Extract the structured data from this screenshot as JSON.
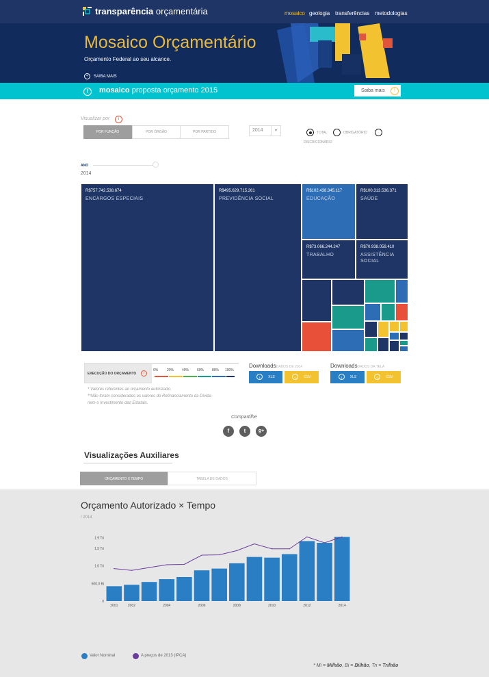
{
  "brand": {
    "bold": "transparência",
    "light": "orçamentária"
  },
  "nav": [
    "mosaico",
    "geologia",
    "transferências",
    "metodologias"
  ],
  "hero": {
    "title": "Mosaico Orçamentário",
    "subtitle": "Orçamento Federal ao seu alcance.",
    "more": "SAIBA MAIS"
  },
  "banner": {
    "bold": "mosaico",
    "text": "proposta orçamento 2015",
    "button": "Saiba mais"
  },
  "controls": {
    "visualizar": "Visualizar por",
    "segments": [
      "POR FUNÇÃO",
      "POR ÓRGÃO",
      "POR PARTIDO"
    ],
    "year": "2014",
    "radios": [
      "TOTAL",
      "OBRIGATÓRIO",
      "DISCRICIONÁRIO"
    ],
    "ano_label": "ANO",
    "ano_value": "2014"
  },
  "treemap": [
    {
      "value": "R$757.742.538.674",
      "name": "ENCARGOS ESPECIAIS",
      "color": "#1e3565"
    },
    {
      "value": "R$495.629.715.261",
      "name": "PREVIDÊNCIA SOCIAL",
      "color": "#1e3565"
    },
    {
      "value": "R$102.438.345.117",
      "name": "EDUCAÇÃO",
      "color": "#2c6db5"
    },
    {
      "value": "R$100.313.536.371",
      "name": "SAÚDE",
      "color": "#1e3565"
    },
    {
      "value": "R$73.066.244.247",
      "name": "TRABALHO",
      "color": "#1e3565"
    },
    {
      "value": "R$70.938.059.410",
      "name": "ASSISTÊNCIA SOCIAL",
      "color": "#1e3565"
    }
  ],
  "execucao": {
    "label": "EXECUÇÃO DO ORÇAMENTO",
    "ticks": [
      "0%",
      "20%",
      "40%",
      "60%",
      "80%",
      "100%"
    ],
    "colors": [
      "#e0563c",
      "#f2c230",
      "#4caf50",
      "#1a9a8a",
      "#2c6db5",
      "#1e3565"
    ]
  },
  "notes": [
    "* Valores referentes ao orçamento autorizado.",
    "**Não foram considerados os valores do Refinanciamento da Dívida",
    "nem o Investimento das Estatais."
  ],
  "downloads": [
    {
      "title": "Downloads",
      "sub": "DADOS DE 2014",
      "xls": "XLS",
      "csv": "CSV"
    },
    {
      "title": "Downloads",
      "sub": "DADOS DA TELA",
      "xls": "XLS",
      "csv": "CSV"
    }
  ],
  "share": "Compartilhe",
  "aux": {
    "title": "Visualizações Auxiliares",
    "tabs": [
      "ORÇAMENTO X TEMPO",
      "TABELA DE DADOS"
    ]
  },
  "chart": {
    "title": "Orçamento Autorizado × Tempo",
    "subtitle": "/ 2014",
    "legend": [
      "Valor Nominal",
      "A preços de 2013 (IPCA)"
    ]
  },
  "footnote": {
    "prefix": "* ",
    "mi": "Mi",
    "mi_val": "Milhão",
    "bi": "Bi",
    "bi_val": "Bilhão",
    "tri": "Tri",
    "tri_val": "Trilhão"
  },
  "chart_data": {
    "type": "bar",
    "categories": [
      "2001",
      "2002",
      "2003",
      "2004",
      "2005",
      "2006",
      "2007",
      "2008",
      "2009",
      "2010",
      "2011",
      "2012",
      "2013",
      "2014"
    ],
    "x_tick_labels": [
      "2001",
      "2002",
      "2004",
      "2006",
      "2008",
      "2010",
      "2012",
      "2014"
    ],
    "y_tick_labels": [
      "0",
      "500.0 Bi",
      "1.0 Tri",
      "1.5 Tri",
      "1.9 Tri"
    ],
    "ylim": [
      0,
      2.0
    ],
    "series": [
      {
        "name": "Valor Nominal",
        "type": "bar",
        "color": "#2a7fc4",
        "values": [
          0.42,
          0.46,
          0.54,
          0.62,
          0.68,
          0.87,
          0.92,
          1.07,
          1.25,
          1.23,
          1.33,
          1.7,
          1.65,
          1.82
        ]
      },
      {
        "name": "A preços de 2013 (IPCA)",
        "type": "line",
        "color": "#6a3d9a",
        "values": [
          0.92,
          0.87,
          0.95,
          1.03,
          1.04,
          1.3,
          1.31,
          1.43,
          1.62,
          1.48,
          1.48,
          1.82,
          1.65,
          1.82
        ]
      }
    ]
  }
}
